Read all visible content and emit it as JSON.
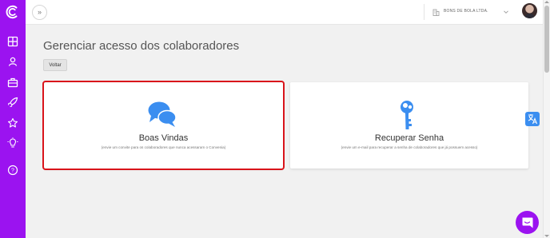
{
  "topbar": {
    "company_name": "BONS DE BOLA LTDA."
  },
  "sidebar": {
    "items": [
      {
        "icon": "dashboard-icon"
      },
      {
        "icon": "user-icon"
      },
      {
        "icon": "briefcase-icon"
      },
      {
        "icon": "rocket-icon"
      },
      {
        "icon": "star-icon"
      },
      {
        "icon": "lightbulb-icon"
      },
      {
        "icon": "help-icon"
      }
    ]
  },
  "main": {
    "title": "Gerenciar acesso dos colaboradores",
    "back_label": "Voltar",
    "cards": [
      {
        "icon": "chat-bubbles-icon",
        "title": "Boas Vindas",
        "subtitle": "(envie um convite para os colaboradores que nunca acessaram o Convenia)"
      },
      {
        "icon": "key-icon",
        "title": "Recuperar Senha",
        "subtitle": "(envie um e-mail para recuperar a senha de colaboradores que já possuem acesso)"
      }
    ]
  },
  "colors": {
    "brand_purple": "#9b13f0",
    "highlight_red": "#d9141b",
    "icon_blue": "#3b8ef0"
  }
}
